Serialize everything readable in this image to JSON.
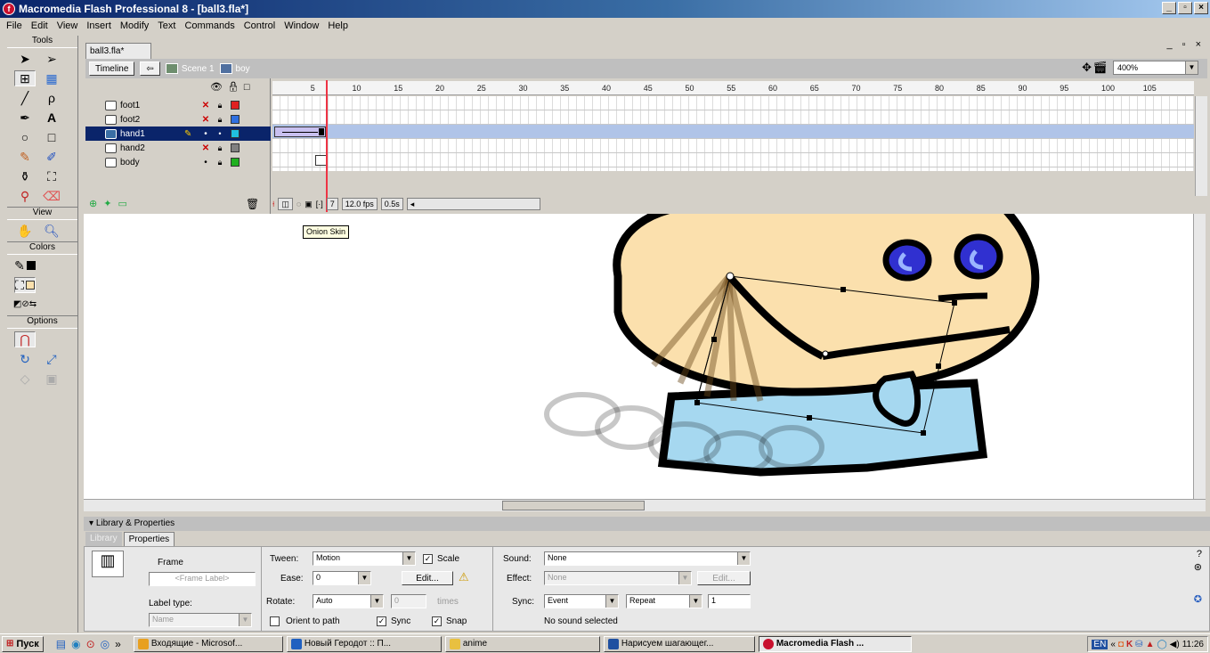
{
  "window": {
    "title": "Macromedia Flash Professional 8 - [ball3.fla*]"
  },
  "menu": [
    "File",
    "Edit",
    "View",
    "Insert",
    "Modify",
    "Text",
    "Commands",
    "Control",
    "Window",
    "Help"
  ],
  "tools": {
    "header": "Tools",
    "view_header": "View",
    "colors_header": "Colors",
    "options_header": "Options"
  },
  "document": {
    "tab": "ball3.fla*",
    "timeline_button": "Timeline",
    "scene": "Scene 1",
    "symbol": "boy",
    "zoom": "400%"
  },
  "timeline": {
    "layers": [
      {
        "name": "foot1",
        "hidden": true,
        "color": "#e02020"
      },
      {
        "name": "foot2",
        "hidden": true,
        "color": "#3070e0"
      },
      {
        "name": "hand1",
        "hidden": false,
        "color": "#20c0e0",
        "selected": true
      },
      {
        "name": "hand2",
        "hidden": true,
        "color": "#808080"
      },
      {
        "name": "body",
        "hidden": false,
        "color": "#20b020"
      }
    ],
    "ruler": [
      "5",
      "10",
      "15",
      "20",
      "25",
      "30",
      "35",
      "40",
      "45",
      "50",
      "55",
      "60",
      "65",
      "70",
      "75",
      "80",
      "85",
      "90",
      "95",
      "100",
      "105"
    ],
    "current_frame": "7",
    "fps": "12.0 fps",
    "time": "0.5s"
  },
  "tooltip": "Onion Skin",
  "properties": {
    "panel_title": "Library & Properties",
    "tabs": [
      "Library",
      "Properties"
    ],
    "frame_label": "Frame",
    "frame_label_placeholder": "<Frame Label>",
    "label_type_label": "Label type:",
    "label_type_value": "Name",
    "tween_label": "Tween:",
    "tween_value": "Motion",
    "scale_label": "Scale",
    "ease_label": "Ease:",
    "ease_value": "0",
    "edit_button": "Edit...",
    "rotate_label": "Rotate:",
    "rotate_value": "Auto",
    "rotate_times_value": "0",
    "times_label": "times",
    "orient_label": "Orient to path",
    "sync_label": "Sync",
    "snap_label": "Snap",
    "sound_label": "Sound:",
    "sound_value": "None",
    "effect_label": "Effect:",
    "effect_value": "None",
    "effect_edit": "Edit...",
    "sync2_label": "Sync:",
    "sync2_value": "Event",
    "repeat_value": "Repeat",
    "repeat_count": "1",
    "no_sound": "No sound selected"
  },
  "taskbar": {
    "start": "Пуск",
    "tasks": [
      "Входящие - Microsof...",
      "Новый Геродот :: П...",
      "anime",
      "Нарисуем шагающег...",
      "Macromedia Flash ..."
    ],
    "lang": "EN",
    "clock": "11:26"
  },
  "colors": {
    "title_start": "#0a246a",
    "title_end": "#a6caf0",
    "face": "#fbe0ad",
    "shirt": "#a6d8f0",
    "eye": "#3030d0",
    "playhead": "#e34"
  }
}
